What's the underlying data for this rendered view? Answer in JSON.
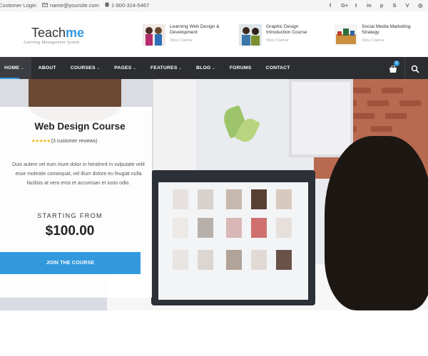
{
  "topbar": {
    "login": "Customer Login",
    "email": "name@yoursite.com",
    "phone": "1-900-324-5467",
    "social_icons": [
      "facebook-icon",
      "google-plus-icon",
      "twitter-icon",
      "linkedin-icon",
      "pinterest-icon",
      "skype-icon",
      "vimeo-icon",
      "instagram-icon"
    ],
    "social_glyphs": [
      "f",
      "G+",
      "t",
      "in",
      "p",
      "S",
      "V",
      "◎"
    ]
  },
  "header": {
    "logo_main": "Teach",
    "logo_accent": "me",
    "logo_sub": "Learning Management System",
    "courses": [
      {
        "title": "Learning Web Design & Development",
        "link": "View Course"
      },
      {
        "title": "Graphic Design Introduction Course",
        "link": "View Course"
      },
      {
        "title": "Social Media Marketing Strategy",
        "link": "View Course"
      }
    ]
  },
  "nav": {
    "items": [
      {
        "label": "HOME",
        "caret": "⌄"
      },
      {
        "label": "ABOUT",
        "caret": ""
      },
      {
        "label": "COURSES",
        "caret": "⌄"
      },
      {
        "label": "PAGES",
        "caret": "⌄"
      },
      {
        "label": "FEATURES",
        "caret": "⌄"
      },
      {
        "label": "BLOG",
        "caret": "⌄"
      },
      {
        "label": "FORUMS",
        "caret": ""
      },
      {
        "label": "CONTACT",
        "caret": ""
      }
    ],
    "cart_count": "0"
  },
  "hero": {
    "course_title": "Web Design Course",
    "stars": "★★★★★",
    "reviews": "(3 customer reviews)",
    "description": "Duis autem vel eum iriure dolor in hendrerit in vulputate velit esse molestie consequat, vel illum dolore eu feugiat nulla facilisis at vero eros et accumsan et iusto odio.",
    "starting_from": "STARTING FROM",
    "price": "$100.00",
    "cta": "JOIN THE COURSE"
  },
  "colors": {
    "accent": "#3399dd",
    "nav_bg": "#2b2d31",
    "star": "#f5b301"
  }
}
